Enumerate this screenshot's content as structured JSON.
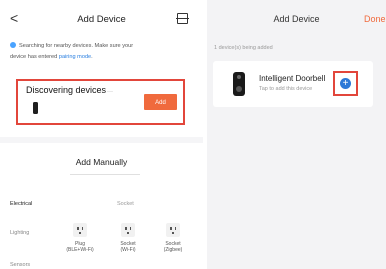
{
  "left": {
    "header": {
      "title": "Add Device",
      "back_glyph": "<"
    },
    "hint": {
      "text_a": "Searching for nearby devices. Make sure your",
      "text_b": "device has entered ",
      "link": "pairing mode",
      "text_c": "."
    },
    "discovering": {
      "title": "Discovering devices",
      "dots": "···",
      "add_label": "Add"
    },
    "add_manually": "Add Manually",
    "categories": [
      "Electrical",
      "Lighting",
      "Sensors"
    ],
    "column_header": "Socket",
    "devices": [
      {
        "line1": "Plug",
        "line2": "(BLE+Wi-Fi)"
      },
      {
        "line1": "Socket",
        "line2": "(Wi-Fi)"
      },
      {
        "line1": "Socket",
        "line2": "(Zigbee)"
      }
    ]
  },
  "right": {
    "title": "Add Device",
    "done": "Done",
    "count": "1 device(s) being added",
    "device": {
      "name": "Intelligent Doorbell",
      "tap": "Tap to add this device"
    },
    "plus": "+"
  },
  "colors": {
    "accent": "#f06a3d",
    "highlight": "#e2463b",
    "blue": "#2d79d7"
  }
}
